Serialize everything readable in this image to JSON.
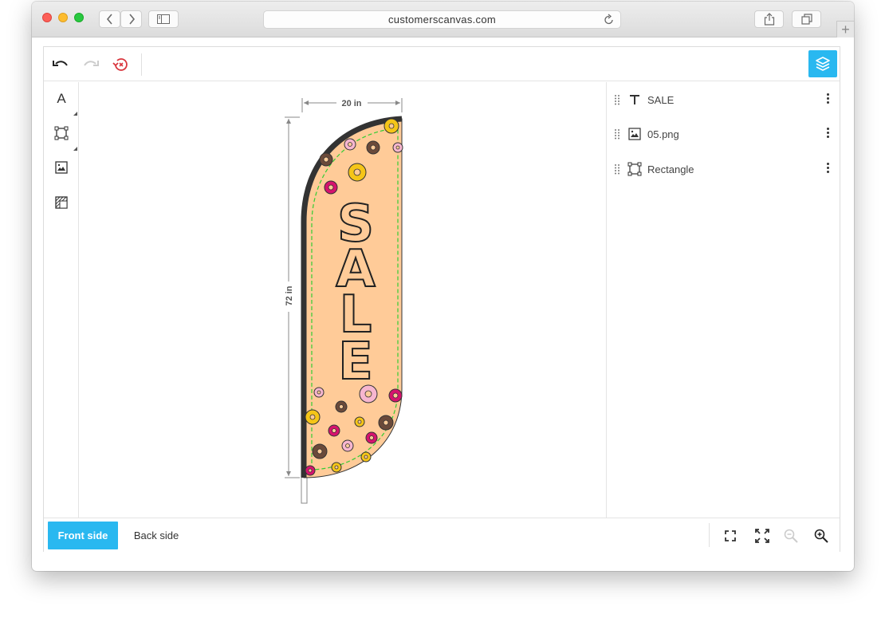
{
  "browser": {
    "url": "customerscanvas.com"
  },
  "toolbar": {
    "undo_icon": "undo-icon",
    "redo_icon": "redo-icon",
    "revert_icon": "history-revert-icon",
    "layers_icon": "layers-icon",
    "accent_color": "#29b8f0"
  },
  "leftbar": {
    "items": [
      {
        "icon": "text-tool-icon",
        "glyph": "A"
      },
      {
        "icon": "shape-tool-icon"
      },
      {
        "icon": "image-tool-icon"
      },
      {
        "icon": "background-tool-icon"
      }
    ]
  },
  "canvas": {
    "width_label": "20 in",
    "height_label": "72 in",
    "flag_text": "SALE",
    "flag_color": "#ffcc99",
    "safety_line_color": "#33cc33"
  },
  "layers": [
    {
      "name": "SALE",
      "icon": "text-layer-icon"
    },
    {
      "name": "05.png",
      "icon": "image-layer-icon"
    },
    {
      "name": "Rectangle",
      "icon": "rectangle-layer-icon"
    }
  ],
  "bottombar": {
    "front_label": "Front side",
    "back_label": "Back side",
    "zoom_icons": [
      "fit-to-screen-icon",
      "fullscreen-icon",
      "zoom-out-icon",
      "zoom-in-icon"
    ]
  }
}
